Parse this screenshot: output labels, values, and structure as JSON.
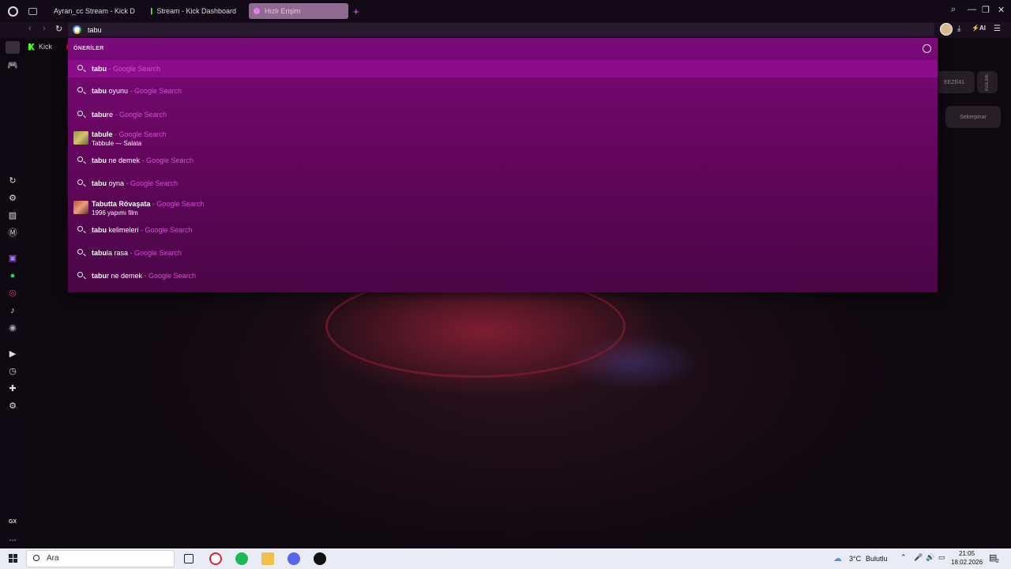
{
  "tabs": [
    {
      "label": "Ayran_cc Stream - Kick D",
      "active": false,
      "icon": "kick-icon"
    },
    {
      "label": "Stream - Kick Dashboard",
      "active": false,
      "icon": "kick-icon"
    },
    {
      "label": "Hızlı Erişim",
      "active": true,
      "icon": "opera-dot-icon"
    }
  ],
  "address_bar": {
    "value": "tabu"
  },
  "bookmarks": {
    "kick_label": "Kick"
  },
  "dropdown": {
    "header": "ÖNERİLER",
    "items": [
      {
        "bold": "tabu",
        "rest": "",
        "source": " - Google Search",
        "sub": "",
        "thumb": ""
      },
      {
        "bold": "tabu",
        "rest": " oyunu",
        "source": " - Google Search",
        "sub": "",
        "thumb": ""
      },
      {
        "bold": "tabu",
        "rest": "re",
        "source": " - Google Search",
        "sub": "",
        "thumb": ""
      },
      {
        "bold": "tabule",
        "rest": "",
        "source": " - Google Search",
        "sub": "Tabbule — Salata",
        "thumb": "food"
      },
      {
        "bold": "tabu",
        "rest": " ne demek",
        "source": " - Google Search",
        "sub": "",
        "thumb": ""
      },
      {
        "bold": "tabu",
        "rest": " oyna",
        "source": " - Google Search",
        "sub": "",
        "thumb": ""
      },
      {
        "bold": "Tabutta Rövaşata",
        "rest": "",
        "source": " - Google Search",
        "sub": "1996 yapımı film",
        "thumb": "film"
      },
      {
        "bold": "tabu",
        "rest": " kelimeleri",
        "source": " - Google Search",
        "sub": "",
        "thumb": ""
      },
      {
        "bold": "tabu",
        "rest": "la rasa",
        "source": " - Google Search",
        "sub": "",
        "thumb": ""
      },
      {
        "bold": "tabu",
        "rest": "r ne demek",
        "source": " - Google Search",
        "sub": "",
        "thumb": ""
      }
    ]
  },
  "background_cards": {
    "card1": "EEZE41",
    "card2": "Sekerpinar",
    "card3": "Kick.ME"
  },
  "sidebar": {
    "gx_label": "GX",
    "more_label": "..."
  },
  "taskbar": {
    "search_placeholder": "Ara",
    "weather_temp": "3°C",
    "weather_desc": "Bulutlu",
    "time": "21:05",
    "date": "18.02.2026",
    "notification_count": "2"
  },
  "colors": {
    "accent": "#8b0d8b",
    "source_text": "#d84bd8",
    "kick_green": "#53fc18"
  }
}
